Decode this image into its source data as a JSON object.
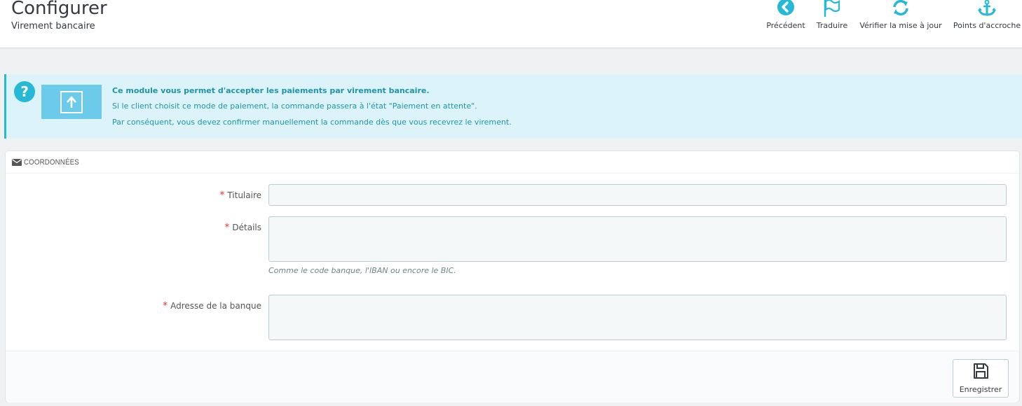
{
  "header": {
    "title": "Configurer",
    "subtitle": "Virement bancaire"
  },
  "toolbar": {
    "back_label": "Précédent",
    "translate_label": "Traduire",
    "update_label": "Vérifier la mise à jour",
    "hooks_label": "Points d'accroche"
  },
  "info": {
    "line1": "Ce module vous permet d'accepter les paiements par virement bancaire.",
    "line2": "Si le client choisit ce mode de paiement, la commande passera à l'état \"Paiement en attente\".",
    "line3": "Par conséquent, vous devez confirmer manuellement la commande dès que vous recevrez le virement."
  },
  "panel": {
    "heading": "COORDONNÉES",
    "fields": [
      {
        "label": "Titulaire",
        "value": "",
        "required": "*"
      },
      {
        "label": "Détails",
        "value": "",
        "required": "*"
      },
      {
        "label": "Adresse de la banque",
        "value": "",
        "required": "*"
      }
    ],
    "details_help": "Comme le code banque, l'IBAN ou encore le BIC.",
    "save_label": "Enregistrer"
  },
  "colors": {
    "accent": "#25b9d7",
    "info_bg": "#dcf4f9",
    "info_text": "#1e94ab",
    "required": "#e33333"
  },
  "icons": {
    "back": "arrow-circle-left-icon",
    "translate": "flag-icon",
    "update": "refresh-icon",
    "hooks": "anchor-icon",
    "help": "question-circle-icon",
    "module": "upload-arrow-icon",
    "heading": "envelope-icon",
    "save": "floppy-disk-icon"
  }
}
